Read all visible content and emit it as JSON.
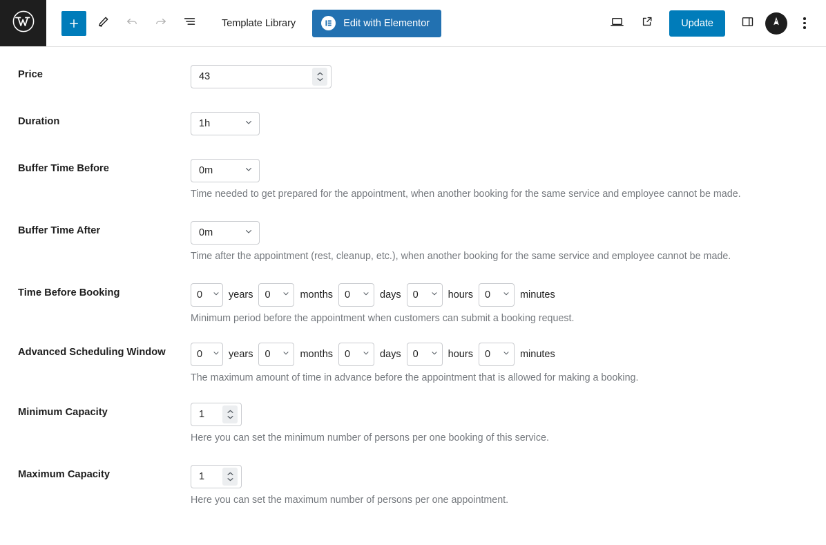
{
  "toolbar": {
    "wp_logo": "wordpress-logo",
    "add_block_label": "+",
    "template_library_label": "Template Library",
    "elementor_button_label": "Edit with Elementor",
    "update_button_label": "Update",
    "accent_blue": "#007cba",
    "elementor_blue": "#2271b1",
    "icons": {
      "add": "plus-icon",
      "tools": "pencil-icon",
      "undo": "undo-arrow-icon",
      "redo": "redo-arrow-icon",
      "list_view": "list-view-icon",
      "preview": "laptop-preview-icon",
      "view_post": "external-link-icon",
      "settings_sidebar": "sidebar-toggle-icon",
      "avatar": "user-avatar-icon",
      "options": "kebab-menu-icon"
    }
  },
  "form": {
    "rows": [
      {
        "label": "Price",
        "type": "number",
        "value": "43",
        "help": ""
      },
      {
        "label": "Duration",
        "type": "select",
        "value": "1h",
        "help": ""
      },
      {
        "label": "Buffer Time Before",
        "type": "select",
        "value": "0m",
        "help": "Time needed to get prepared for the appointment, when another booking for the same service and employee cannot be made."
      },
      {
        "label": "Buffer Time After",
        "type": "select",
        "value": "0m",
        "help": "Time after the appointment (rest, cleanup, etc.), when another booking for the same service and employee cannot be made."
      },
      {
        "label": "Time Before Booking",
        "type": "duration-group",
        "help": "Minimum period before the appointment when customers can submit a booking request.",
        "units": [
          {
            "value": "0",
            "unit": "years"
          },
          {
            "value": "0",
            "unit": "months"
          },
          {
            "value": "0",
            "unit": "days"
          },
          {
            "value": "0",
            "unit": "hours"
          },
          {
            "value": "0",
            "unit": "minutes"
          }
        ]
      },
      {
        "label": "Advanced Scheduling Window",
        "type": "duration-group",
        "help": "The maximum amount of time in advance before the appointment that is allowed for making a booking.",
        "units": [
          {
            "value": "0",
            "unit": "years"
          },
          {
            "value": "0",
            "unit": "months"
          },
          {
            "value": "0",
            "unit": "days"
          },
          {
            "value": "0",
            "unit": "hours"
          },
          {
            "value": "0",
            "unit": "minutes"
          }
        ]
      },
      {
        "label": "Minimum Capacity",
        "type": "number",
        "value": "1",
        "help": "Here you can set the minimum number of persons per one booking of this service."
      },
      {
        "label": "Maximum Capacity",
        "type": "number",
        "value": "1",
        "help": "Here you can set the maximum number of persons per one appointment."
      }
    ]
  }
}
